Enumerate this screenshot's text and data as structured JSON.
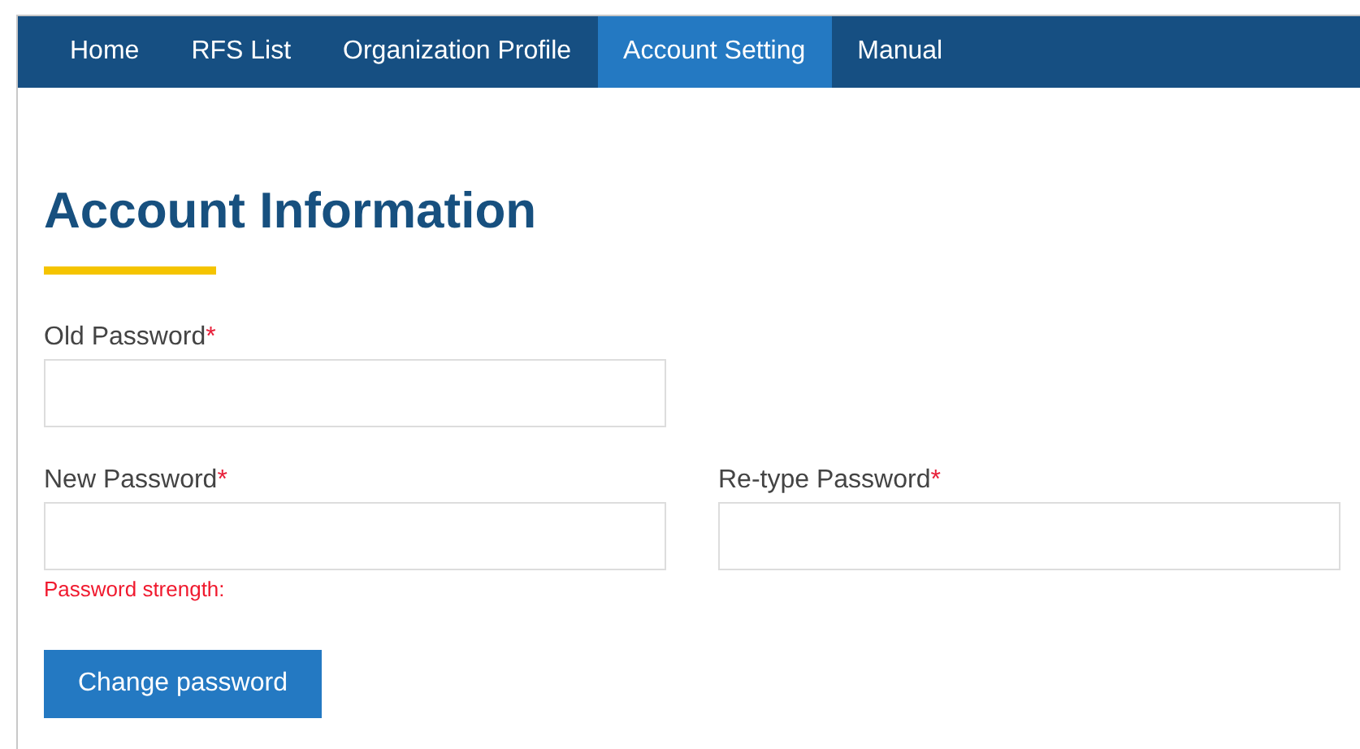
{
  "nav": [
    {
      "label": "Home",
      "selected": false
    },
    {
      "label": "RFS List",
      "selected": false
    },
    {
      "label": "Organization Profile",
      "selected": false
    },
    {
      "label": "Account Setting",
      "selected": true
    },
    {
      "label": "Manual",
      "selected": false
    }
  ],
  "heading": "Account Information",
  "rows": [
    [
      {
        "label": "Old Password",
        "required_mark": "*"
      }
    ],
    [
      {
        "label": "New Password",
        "required_mark": "*",
        "hint": "Password strength:"
      },
      {
        "label": "Re-type Password",
        "required_mark": "*"
      }
    ]
  ],
  "button": "Change password"
}
